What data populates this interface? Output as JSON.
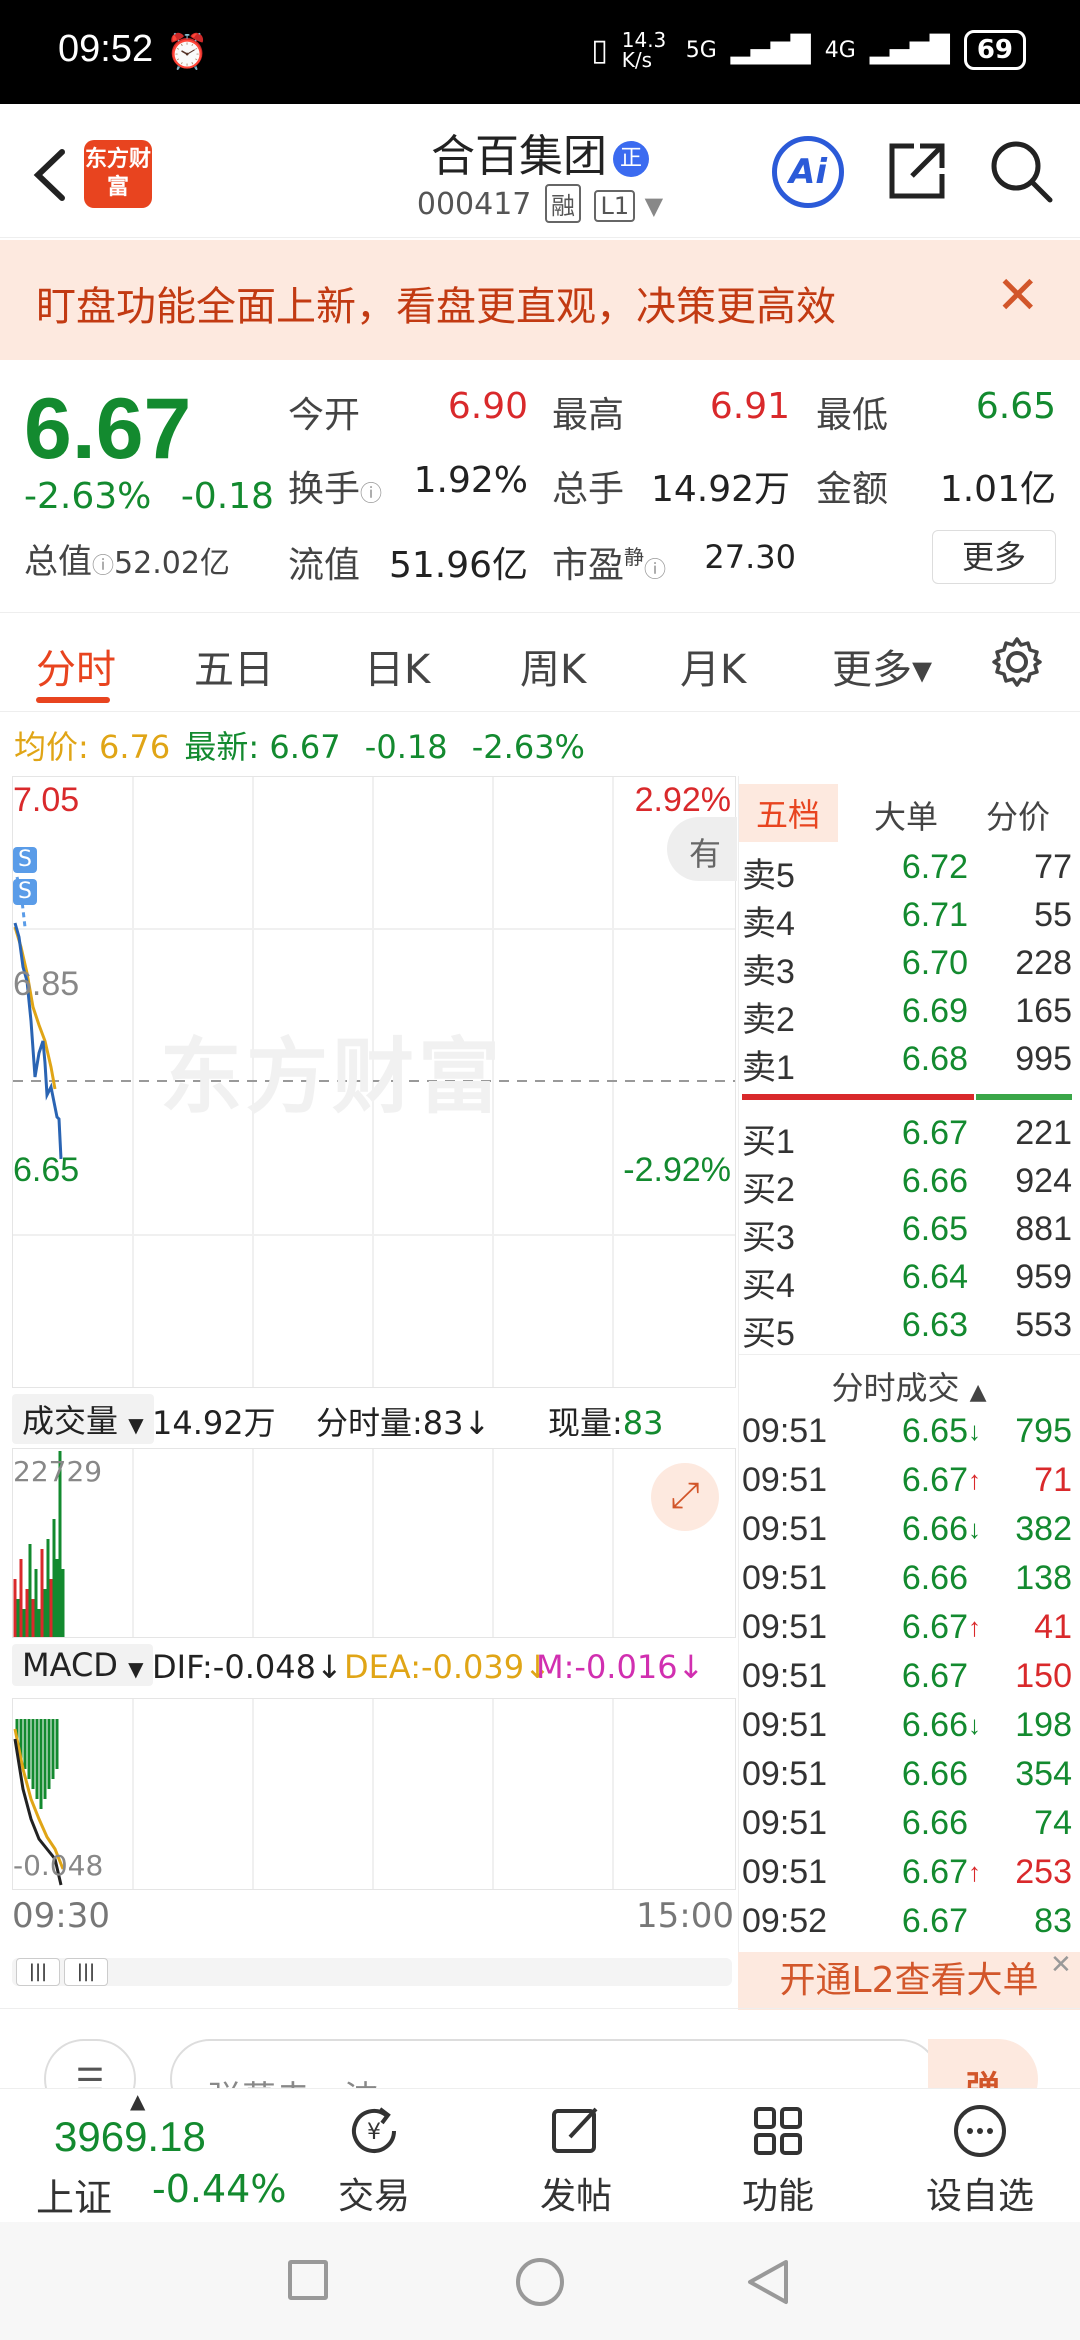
{
  "status_bar": {
    "time": "09:52",
    "net_speed": "14.3 K/s",
    "net1": "5G",
    "net2": "4G",
    "battery": "69"
  },
  "header": {
    "logo_text": "东方财富",
    "stock_name": "合百集团",
    "name_badge": "正",
    "code": "000417",
    "tag_rong": "融",
    "tag_level": "L1",
    "ai_label": "Ai"
  },
  "banner": {
    "text": "盯盘功能全面上新，看盘更直观，决策更高效",
    "close": "✕"
  },
  "quote": {
    "price": "6.67",
    "change_pct": "-2.63%",
    "change_amt": "-0.18",
    "total_value_label": "总值",
    "total_value": "52.02亿",
    "open_label": "今开",
    "open": "6.90",
    "high_label": "最高",
    "high": "6.91",
    "low_label": "最低",
    "low": "6.65",
    "turnover_label": "换手",
    "turnover": "1.92%",
    "volume_label": "总手",
    "volume": "14.92万",
    "amount_label": "金额",
    "amount": "1.01亿",
    "float_label": "流值",
    "float_value": "51.96亿",
    "pe_label": "市盈",
    "pe_sup": "静",
    "pe": "27.30",
    "more": "更多"
  },
  "tabs": [
    {
      "label": "分时"
    },
    {
      "label": "五日"
    },
    {
      "label": "日K"
    },
    {
      "label": "周K"
    },
    {
      "label": "月K"
    },
    {
      "label": "更多▾"
    }
  ],
  "avg_line": {
    "avg_label": "均价:",
    "avg_value": "6.76",
    "latest_label": "最新:",
    "latest_value": "6.67",
    "chg": "-0.18",
    "pct": "-2.63%"
  },
  "chart_labels": {
    "top_left": "7.05",
    "top_right": "2.92%",
    "mid_left": "6.85",
    "bottom_left": "6.65",
    "bottom_right": "-2.92%",
    "marker": "S",
    "side_tab": "有",
    "watermark": "东方财富",
    "time_start": "09:30",
    "time_end": "15:00"
  },
  "volume_bar": {
    "dropdown": "成交量",
    "total": "14.92万",
    "minute_label": "分时量:",
    "minute_value": "83",
    "current_label": "现量:",
    "current_value": "83",
    "max_label": "22729"
  },
  "macd_bar": {
    "dropdown": "MACD",
    "dif": "DIF:-0.048",
    "dea": "DEA:-0.039",
    "m": "M:-0.016",
    "bottom_label": "-0.048"
  },
  "order_book": {
    "tabs": [
      "五档",
      "大单",
      "分价"
    ],
    "asks": [
      {
        "name": "卖5",
        "price": "6.72",
        "vol": "77"
      },
      {
        "name": "卖4",
        "price": "6.71",
        "vol": "55"
      },
      {
        "name": "卖3",
        "price": "6.70",
        "vol": "228"
      },
      {
        "name": "卖2",
        "price": "6.69",
        "vol": "165"
      },
      {
        "name": "卖1",
        "price": "6.68",
        "vol": "995"
      }
    ],
    "bids": [
      {
        "name": "买1",
        "price": "6.67",
        "vol": "221"
      },
      {
        "name": "买2",
        "price": "6.66",
        "vol": "924"
      },
      {
        "name": "买3",
        "price": "6.65",
        "vol": "881"
      },
      {
        "name": "买4",
        "price": "6.64",
        "vol": "959"
      },
      {
        "name": "买5",
        "price": "6.63",
        "vol": "553"
      }
    ],
    "trades_title": "分时成交",
    "trades": [
      {
        "time": "09:51",
        "price": "6.65",
        "dir": "↓",
        "vol": "795",
        "color": "#138a2f",
        "vcolor": "#138a2f"
      },
      {
        "time": "09:51",
        "price": "6.67",
        "dir": "↑",
        "vol": "71",
        "color": "#138a2f",
        "vcolor": "#d9292b"
      },
      {
        "time": "09:51",
        "price": "6.66",
        "dir": "↓",
        "vol": "382",
        "color": "#138a2f",
        "vcolor": "#138a2f"
      },
      {
        "time": "09:51",
        "price": "6.66",
        "dir": "",
        "vol": "138",
        "color": "#138a2f",
        "vcolor": "#138a2f"
      },
      {
        "time": "09:51",
        "price": "6.67",
        "dir": "↑",
        "vol": "41",
        "color": "#138a2f",
        "vcolor": "#d9292b"
      },
      {
        "time": "09:51",
        "price": "6.67",
        "dir": "",
        "vol": "150",
        "color": "#138a2f",
        "vcolor": "#d9292b"
      },
      {
        "time": "09:51",
        "price": "6.66",
        "dir": "↓",
        "vol": "198",
        "color": "#138a2f",
        "vcolor": "#138a2f"
      },
      {
        "time": "09:51",
        "price": "6.66",
        "dir": "",
        "vol": "354",
        "color": "#138a2f",
        "vcolor": "#138a2f"
      },
      {
        "time": "09:51",
        "price": "6.66",
        "dir": "",
        "vol": "74",
        "color": "#138a2f",
        "vcolor": "#138a2f"
      },
      {
        "time": "09:51",
        "price": "6.67",
        "dir": "↑",
        "vol": "253",
        "color": "#138a2f",
        "vcolor": "#d9292b"
      },
      {
        "time": "09:52",
        "price": "6.67",
        "dir": "",
        "vol": "83",
        "color": "#138a2f",
        "vcolor": "#138a2f"
      }
    ],
    "l2_text": "开通L2查看大单",
    "l2_close": "✕"
  },
  "comment": {
    "placeholder": "弹幕走一波",
    "send": "弹"
  },
  "bottom_nav": {
    "index_value": "3969.18",
    "index_name": "上证",
    "index_change": "-0.44%",
    "items": [
      {
        "label": "交易"
      },
      {
        "label": "发帖"
      },
      {
        "label": "功能"
      },
      {
        "label": "设自选"
      }
    ]
  },
  "colors": {
    "up": "#d9292b",
    "down": "#138a2f",
    "accent": "#e8441f",
    "avg": "#e0a516"
  }
}
